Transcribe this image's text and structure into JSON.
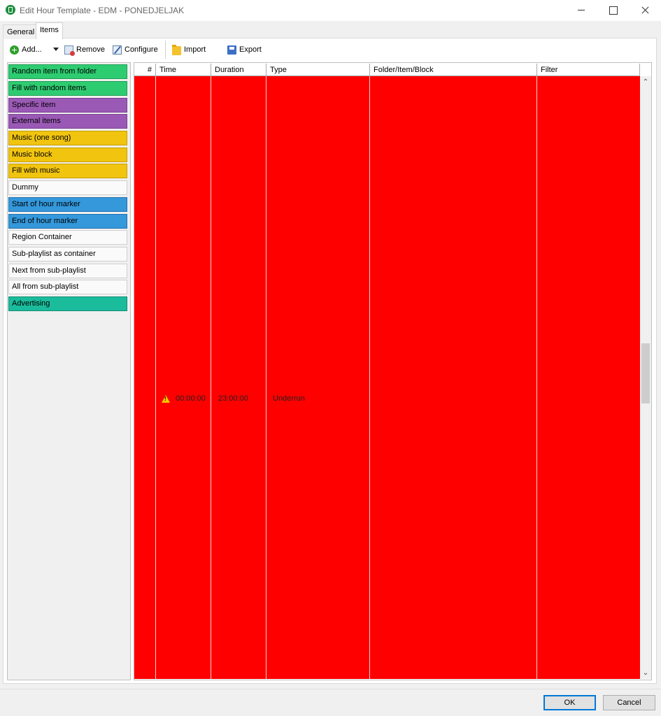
{
  "window": {
    "title": "Edit Hour Template - EDM - PONEDJELJAK"
  },
  "tabs": [
    {
      "label": "General",
      "active": false
    },
    {
      "label": "Items",
      "active": true
    }
  ],
  "toolbar": {
    "add_label": "Add...",
    "remove_label": "Remove",
    "configure_label": "Configure",
    "import_label": "Import",
    "export_label": "Export"
  },
  "palette": {
    "items": [
      {
        "label": "Random item from folder",
        "color": "#2ecc71"
      },
      {
        "label": "Fill with random items",
        "color": "#2ecc71"
      },
      {
        "label": "Specific item",
        "color": "#9b59b6"
      },
      {
        "label": "External items",
        "color": "#9b59b6"
      },
      {
        "label": "Music (one song)",
        "color": "#f1c40f"
      },
      {
        "label": "Music block",
        "color": "#f1c40f"
      },
      {
        "label": "Fill with music",
        "color": "#f1c40f"
      },
      {
        "label": "Dummy",
        "color": "#fafafa"
      },
      {
        "label": "Start of hour marker",
        "color": "#3498db"
      },
      {
        "label": "End of hour marker",
        "color": "#3498db"
      },
      {
        "label": "Region Container",
        "color": "#fafafa"
      },
      {
        "label": "Sub-playlist as container",
        "color": "#fafafa"
      },
      {
        "label": "Next from sub-playlist",
        "color": "#fafafa"
      },
      {
        "label": "All from sub-playlist",
        "color": "#fafafa"
      },
      {
        "label": "Advertising",
        "color": "#1abc9c"
      }
    ]
  },
  "grid": {
    "columns": [
      "#",
      "Time",
      "Duration",
      "Type",
      "Folder/Item/Block",
      "Filter"
    ],
    "rows": [
      {
        "number": "",
        "time": "00:00:00",
        "duration": "23:00:00",
        "type": "Underrun",
        "folder": "",
        "filter": "",
        "warning": true,
        "row_color": "#ff0000"
      }
    ]
  },
  "buttons": {
    "ok_label": "OK",
    "cancel_label": "Cancel"
  },
  "icons": {
    "app": "hour-template-icon",
    "add": "add-icon",
    "remove": "remove-icon",
    "configure": "configure-icon",
    "import": "folder-icon",
    "export": "save-icon",
    "warning": "warning-icon"
  }
}
